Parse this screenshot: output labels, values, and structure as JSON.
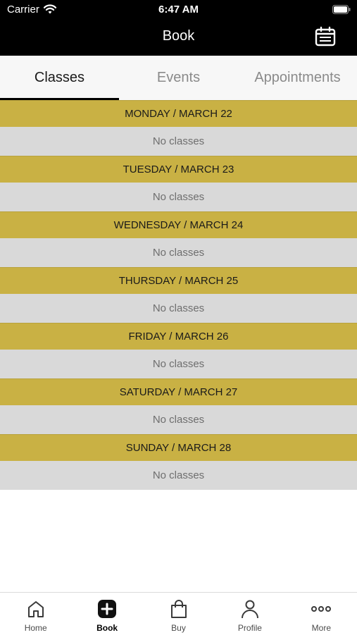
{
  "status_bar": {
    "carrier": "Carrier",
    "time": "6:47 AM"
  },
  "header": {
    "title": "Book",
    "action_icon": "calendar-icon"
  },
  "tabs": [
    {
      "label": "Classes",
      "active": true
    },
    {
      "label": "Events",
      "active": false
    },
    {
      "label": "Appointments",
      "active": false
    }
  ],
  "days": [
    {
      "date": "MONDAY / MARCH 22",
      "status": "No classes"
    },
    {
      "date": "TUESDAY / MARCH 23",
      "status": "No classes"
    },
    {
      "date": "WEDNESDAY / MARCH 24",
      "status": "No classes"
    },
    {
      "date": "THURSDAY / MARCH 25",
      "status": "No classes"
    },
    {
      "date": "FRIDAY / MARCH 26",
      "status": "No classes"
    },
    {
      "date": "SATURDAY / MARCH 27",
      "status": "No classes"
    },
    {
      "date": "SUNDAY / MARCH 28",
      "status": "No classes"
    }
  ],
  "tabbar": [
    {
      "label": "Home",
      "icon": "home-icon",
      "active": false
    },
    {
      "label": "Book",
      "icon": "plus-icon",
      "active": true
    },
    {
      "label": "Buy",
      "icon": "bag-icon",
      "active": false
    },
    {
      "label": "Profile",
      "icon": "person-icon",
      "active": false
    },
    {
      "label": "More",
      "icon": "more-icon",
      "active": false
    }
  ],
  "colors": {
    "day_header": "#c9b144",
    "day_row": "#d9d9d9",
    "header_bg": "#000000"
  }
}
